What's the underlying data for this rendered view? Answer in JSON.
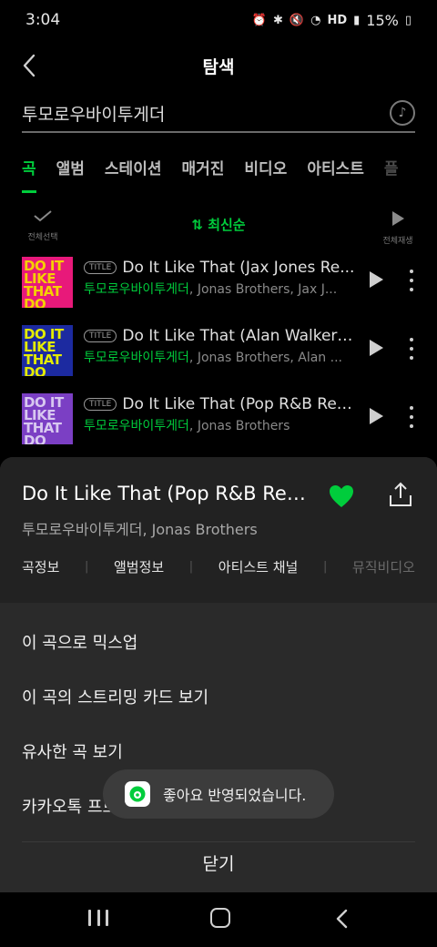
{
  "status": {
    "time": "3:04",
    "battery": "15%",
    "network_label": "HD"
  },
  "header": {
    "title": "탐색"
  },
  "search": {
    "value": "투모로우바이투게더"
  },
  "tabs": [
    {
      "label": "곡",
      "active": true
    },
    {
      "label": "앨범"
    },
    {
      "label": "스테이션"
    },
    {
      "label": "매거진"
    },
    {
      "label": "비디오"
    },
    {
      "label": "아티스트"
    },
    {
      "label": "플"
    }
  ],
  "list_controls": {
    "select_all": "전체선택",
    "sort": "최신순",
    "play_all": "전체재생"
  },
  "songs": [
    {
      "badge": "TITLE",
      "title": "Do It Like That (Jax Jones Re...",
      "artist_highlight": "투모로우바이투게더",
      "artist_rest": ", Jonas Brothers, Jax J...",
      "art_text": "DO IT LIKE THAT DO",
      "art_bg": "#e8197a",
      "art_fg": "#f5d000"
    },
    {
      "badge": "TITLE",
      "title": "Do It Like That (Alan Walker R...",
      "artist_highlight": "투모로우바이투게더",
      "artist_rest": ", Jonas Brothers, Alan ...",
      "art_text": "DO IT LIKE THAT DO",
      "art_bg": "#1c2aa0",
      "art_fg": "#e4ec00"
    },
    {
      "badge": "TITLE",
      "title": "Do It Like That (Pop R&B Remi...",
      "artist_highlight": "투모로우바이투게더",
      "artist_rest": ", Jonas Brothers",
      "art_text": "DO IT LIKE THAT DO",
      "art_bg": "#7b3fc4",
      "art_fg": "#d8c8f0"
    }
  ],
  "sheet": {
    "title": "Do It Like That (Pop R&B Rem...",
    "artist": "투모로우바이투게더, Jonas Brothers",
    "links": [
      "곡정보",
      "앨범정보",
      "아티스트 채널",
      "뮤직비디오"
    ],
    "menu": [
      "이 곡으로 믹스업",
      "이 곡의 스트리밍 카드 보기",
      "유사한 곡 보기",
      "카카오톡 프로필뮤직 설정"
    ],
    "close": "닫기"
  },
  "toast": {
    "text": "좋아요 반영되었습니다."
  },
  "colors": {
    "accent": "#00cd3c",
    "background": "#000000",
    "sheet": "#2a2a2a"
  },
  "icons": {
    "back": "chevron-left-icon",
    "music": "music-note-icon",
    "heart": "heart-icon",
    "share": "share-icon"
  }
}
